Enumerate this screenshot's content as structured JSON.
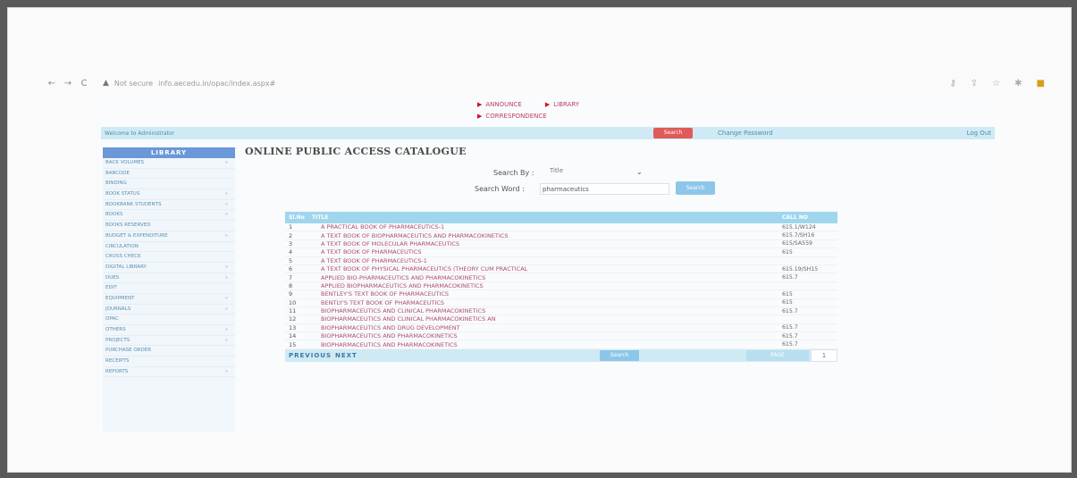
{
  "browser": {
    "url_prefix": "Not secure",
    "url": "info.aecedu.in/opac/index.aspx#",
    "reload": "C",
    "warn": "▲"
  },
  "toplinks": {
    "row1": [
      "ANNOUNCE",
      "LIBRARY"
    ],
    "row2": [
      "CORRESPONDENCE"
    ]
  },
  "welcome": {
    "text": "Welcome to Administrator",
    "search_label": "Search",
    "change_password": "Change Password",
    "logout": "Log Out"
  },
  "sidebar": {
    "title": "LIBRARY",
    "items": [
      {
        "label": "BACK VOLUMES",
        "arrow": true
      },
      {
        "label": "BARCODE",
        "arrow": false
      },
      {
        "label": "BINDING",
        "arrow": false
      },
      {
        "label": "BOOK STATUS",
        "arrow": true
      },
      {
        "label": "BOOKBANK STUDENTS",
        "arrow": true
      },
      {
        "label": "BOOKS",
        "arrow": true
      },
      {
        "label": "BOOKS RESERVED",
        "arrow": false
      },
      {
        "label": "BUDGET & EXPENDITURE",
        "arrow": true
      },
      {
        "label": "CIRCULATION",
        "arrow": false
      },
      {
        "label": "CROSS CHECK",
        "arrow": false
      },
      {
        "label": "DIGITAL LIBRARY",
        "arrow": true
      },
      {
        "label": "DUES",
        "arrow": true
      },
      {
        "label": "EDIT",
        "arrow": false
      },
      {
        "label": "EQUIPMENT",
        "arrow": true
      },
      {
        "label": "JOURNALS",
        "arrow": true
      },
      {
        "label": "OPAC",
        "arrow": false
      },
      {
        "label": "OTHERS",
        "arrow": true
      },
      {
        "label": "PROJECTS",
        "arrow": true
      },
      {
        "label": "PURCHASE ORDER",
        "arrow": false
      },
      {
        "label": "RECEIPTS",
        "arrow": false
      },
      {
        "label": "REPORTS",
        "arrow": true
      }
    ]
  },
  "main": {
    "title": "ONLINE PUBLIC ACCESS CATALOGUE",
    "search_by_label": "Search By :",
    "search_by_value": "Title",
    "search_word_label": "Search Word :",
    "search_word_value": "pharmaceutics",
    "search_button": "Search"
  },
  "table": {
    "headers": [
      "Sl.No",
      "TITLE",
      "CALL NO"
    ],
    "rows": [
      {
        "no": "1",
        "title": "A PRACTICAL BOOK OF PHARMACEUTICS-1",
        "call": "615.1/W124"
      },
      {
        "no": "2",
        "title": "A TEXT BOOK OF BIOPHARMACEUTICS AND PHARMACOKINETICS",
        "call": "615.7/SH16"
      },
      {
        "no": "3",
        "title": "A TEXT BOOK OF MOLECULAR PHARMACEUTICS",
        "call": "615/SA559"
      },
      {
        "no": "4",
        "title": "A TEXT BOOK OF PHARMACEUTICS",
        "call": "615"
      },
      {
        "no": "5",
        "title": "A TEXT BOOK OF PHARMACEUTICS-1",
        "call": ""
      },
      {
        "no": "6",
        "title": "A TEXT BOOK OF PHYSICAL PHARMACEUTICS (THEORY CUM PRACTICAL",
        "call": "615.19/SH15"
      },
      {
        "no": "7",
        "title": "APPLIED BIO-PHARMACEUTICS AND PHARMACOKINETICS",
        "call": "615.7"
      },
      {
        "no": "8",
        "title": "APPLIED BIOPHARMACEUTICS AND PHARMACOKINETICS",
        "call": ""
      },
      {
        "no": "9",
        "title": "BENTLEY'S TEXT BOOK OF PHARMACEUTICS",
        "call": "615"
      },
      {
        "no": "10",
        "title": "BENTLY'S TEXT BOOK OF PHARMACEUTICS",
        "call": "615"
      },
      {
        "no": "11",
        "title": "BIOPHARMACEUTICS AND CLINICAL PHARMACOKINETICS",
        "call": "615.7"
      },
      {
        "no": "12",
        "title": "BIOPHARMACEUTICS AND CLINICAL PHARMACOKINETICS AN",
        "call": ""
      },
      {
        "no": "13",
        "title": "BIOPHARMACEUTICS AND DRUG DEVELOPMENT",
        "call": "615.7"
      },
      {
        "no": "14",
        "title": "BIOPHARMACEUTICS AND PHARMACOKINETICS",
        "call": "615.7"
      },
      {
        "no": "15",
        "title": "BIOPHARMACEUTICS AND PHARMACOKINETICS",
        "call": "615.7"
      }
    ],
    "prev": "PREVIOUS",
    "next": "NEXT",
    "go_button": "Search",
    "page_button": "PAGE",
    "page_select": "1"
  },
  "colors": {
    "accent": "#9fd6ee",
    "link": "#b04a78",
    "sidebar_head": "#6a98d8",
    "danger": "#e05a5a"
  }
}
